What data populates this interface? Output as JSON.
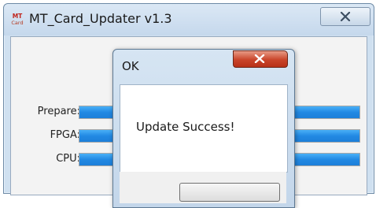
{
  "window": {
    "logo_top": "MT",
    "logo_bottom": "Card",
    "title": "MT_Card_Updater v1.3",
    "close_icon": "close-icon"
  },
  "rows": [
    {
      "label": "Prepare:",
      "progress": 1.0
    },
    {
      "label": "FPGA:",
      "progress": 1.0
    },
    {
      "label": "CPU:",
      "progress": 1.0
    }
  ],
  "dialog": {
    "title": "OK",
    "message": "Update Success!",
    "ok_label": "",
    "close_icon": "close-icon"
  },
  "colors": {
    "progress_fill": "#2289e3",
    "dialog_close": "#c9442a"
  }
}
